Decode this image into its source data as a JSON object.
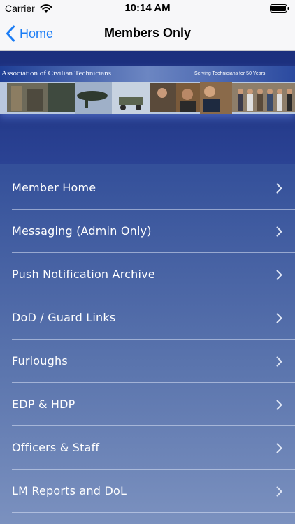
{
  "status_bar": {
    "carrier": "Carrier",
    "time": "10:14 AM",
    "wifi_icon": "wifi-icon",
    "battery_icon": "battery-icon"
  },
  "nav_bar": {
    "back_label": "Home",
    "back_icon": "chevron-left-icon",
    "title": "Members Only",
    "accent_color": "#1a7cf5"
  },
  "banner": {
    "title": "Association of Civilian Technicians",
    "tagline": "Serving Technicians for 50 Years"
  },
  "menu": {
    "chevron_icon": "chevron-right-icon",
    "items": [
      {
        "label": "Member Home"
      },
      {
        "label": "Messaging (Admin Only)"
      },
      {
        "label": "Push Notification Archive"
      },
      {
        "label": "DoD / Guard Links"
      },
      {
        "label": "Furloughs"
      },
      {
        "label": "EDP & HDP"
      },
      {
        "label": "Officers & Staff"
      },
      {
        "label": "LM Reports and DoL"
      }
    ]
  },
  "colors": {
    "background_top": "#26408e",
    "background_bottom": "#7b91bf",
    "menu_text": "#ffffff"
  }
}
